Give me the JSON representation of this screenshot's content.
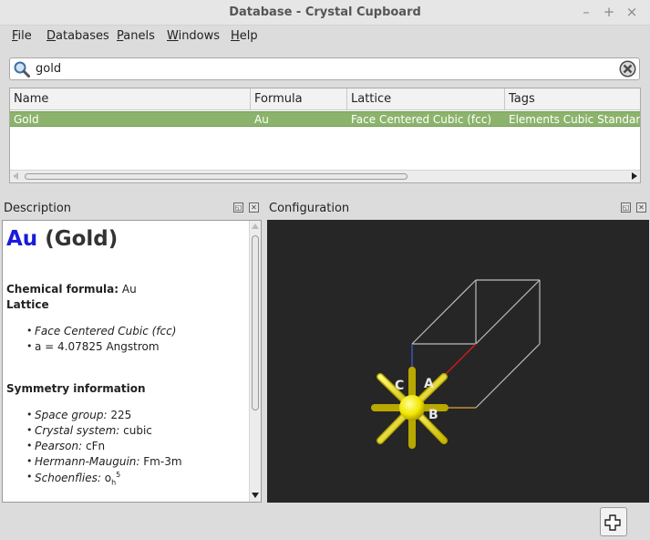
{
  "window": {
    "title": "Database - Crystal Cupboard",
    "controls": [
      "–",
      "+",
      "×"
    ]
  },
  "menu": [
    {
      "underline": "F",
      "rest": "ile"
    },
    {
      "underline": "D",
      "rest": "atabases"
    },
    {
      "underline": "P",
      "rest": "anels"
    },
    {
      "underline": "W",
      "rest": "indows"
    },
    {
      "underline": "H",
      "rest": "elp"
    }
  ],
  "search": {
    "value": "gold",
    "icon": "search-icon",
    "clear_icon": "clear-icon"
  },
  "table": {
    "columns": [
      "Name",
      "Formula",
      "Lattice",
      "Tags"
    ],
    "rows": [
      {
        "name": "Gold",
        "formula": "Au",
        "lattice": "Face Centered Cubic (fcc)",
        "tags": "Elements Cubic Standard p",
        "selected": true
      }
    ],
    "selection_color": "#8cb36c"
  },
  "description_panel": {
    "title": "Description",
    "heading_symbol": "Au",
    "heading_name": "(Gold)",
    "chemical_formula_label": "Chemical formula:",
    "chemical_formula_value": "Au",
    "lattice_label": "Lattice",
    "lattice_items": [
      {
        "italic": "Face Centered Cubic (fcc)",
        "text": ""
      },
      {
        "italic": "",
        "text": "a = 4.07825 Angstrom"
      }
    ],
    "symmetry_label": "Symmetry information",
    "symmetry_items": [
      {
        "label": "Space group:",
        "value": "225"
      },
      {
        "label": "Crystal system:",
        "value": "cubic"
      },
      {
        "label": "Pearson:",
        "value": "cFn"
      },
      {
        "label": "Hermann-Mauguin:",
        "value": "Fm-3m"
      },
      {
        "label": "Schoenflies:",
        "value": "o",
        "sub": "h",
        "sup": "5"
      }
    ]
  },
  "configuration_panel": {
    "title": "Configuration",
    "axis_labels": [
      "C",
      "A",
      "B"
    ],
    "background": "#262626",
    "atom_color": "#f2e600"
  },
  "panel_icons": [
    "float-icon",
    "close-icon"
  ],
  "bottom_button_icon": "add-panel-icon"
}
